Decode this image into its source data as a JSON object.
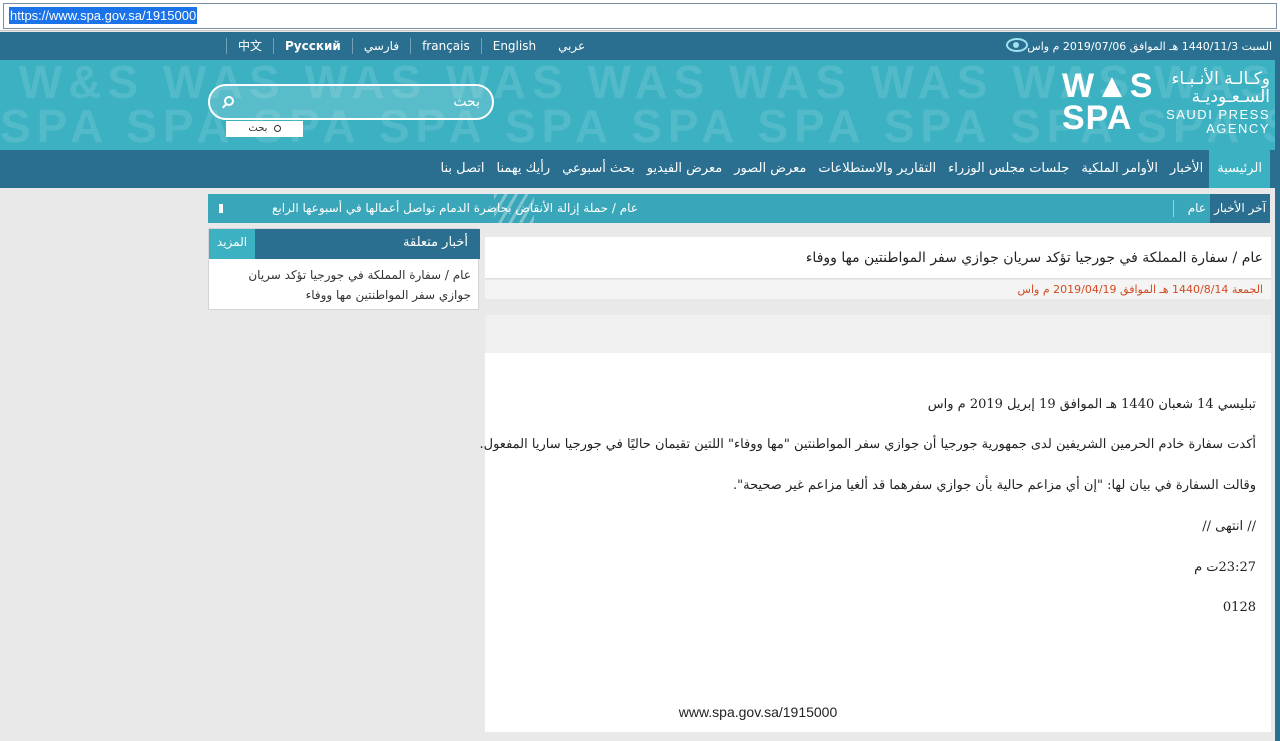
{
  "browser": {
    "url": "https://www.spa.gov.sa/1915000"
  },
  "topbar": {
    "languages": [
      "عربي",
      "English",
      "français",
      "فارسي",
      "Русский",
      "中文"
    ],
    "date_line": "السبت 1440/11/3 هـ الموافق 2019/07/06 م واس"
  },
  "search": {
    "placeholder": "بحث",
    "button_label": "بحث"
  },
  "logo": {
    "arabic": "وكـالـة الأنـبـاء السـعـوديـة",
    "english": "SAUDI PRESS AGENCY",
    "mark": "WAS SPA"
  },
  "nav": {
    "items": [
      "الرئيسية",
      "الأخبار",
      "الأوامر الملكية",
      "جلسات مجلس الوزراء",
      "التقارير والاستطلاعات",
      "معرض الصور",
      "معرض الفيديو",
      "بحث أسبوعي",
      "رأيك يهمنا",
      "اتصل بنا"
    ],
    "active_index": 0
  },
  "ticker": {
    "label": "آخر الأخبار",
    "category": "عام",
    "text": "عام / حملة إزالة الأنقاض بحاضرة الدمام تواصل أعمالها في أسبوعها الرابع"
  },
  "related": {
    "title": "أخبار متعلقة",
    "more_label": "المزيد",
    "items": [
      "عام / سفارة المملكة في جورجيا تؤكد سريان جوازي سفر المواطنتين مها ووفاء"
    ]
  },
  "article": {
    "title": "عام / سفارة المملكة في جورجيا تؤكد سريان جوازي سفر المواطنتين مها ووفاء",
    "date": "الجمعة 1440/8/14 هـ الموافق 2019/04/19 م واس",
    "paragraphs": [
      "تبليسي 14 شعبان 1440 هـ الموافق 19 إبريل 2019 م واس",
      "أكدت سفارة خادم الحرمين الشريفين لدى جمهورية جورجيا أن جوازي سفر المواطنتين \"مها ووفاء\" اللتين تقيمان حاليًا في جورجيا ساريا المفعول.",
      "وقالت السفارة في بيان لها: \"إن أي مزاعم حالية بأن جوازي سفرهما قد ألغيا مزاعم غير صحيحة\".",
      "// انتهى //",
      "23:27ت م",
      "0128"
    ],
    "source": "www.spa.gov.sa/1915000"
  },
  "colors": {
    "dark_teal": "#2a6f8f",
    "light_teal": "#3bb1c1",
    "date_orange": "#d14b1f"
  }
}
